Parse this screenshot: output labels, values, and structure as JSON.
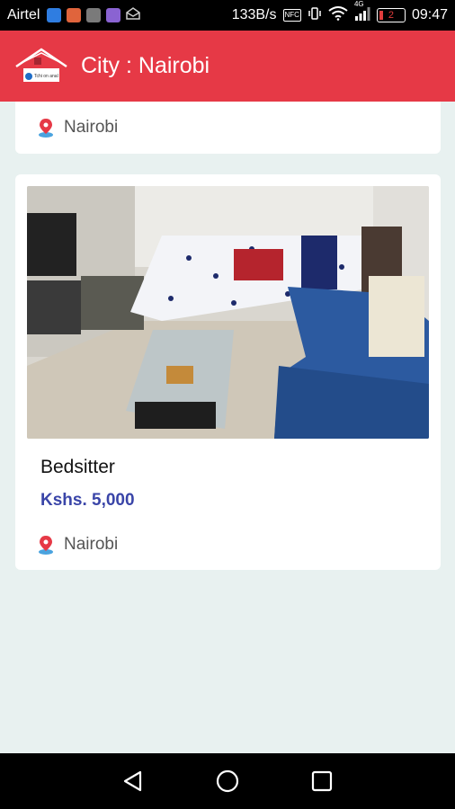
{
  "status_bar": {
    "carrier": "Airtel",
    "speed": "133B/s",
    "nfc": "NFC",
    "network": "4G",
    "battery": "2",
    "time": "09:47"
  },
  "app_bar": {
    "title": "City : Nairobi",
    "logo_text": "Tchi on anal"
  },
  "listings": [
    {
      "location": "Nairobi"
    },
    {
      "title": "Bedsitter",
      "price": "Kshs. 5,000",
      "location": "Nairobi",
      "image": "bedsitter-room-photo"
    }
  ],
  "colors": {
    "app_bar": "#e63946",
    "price": "#3a45a8",
    "background": "#e8f1f0"
  }
}
